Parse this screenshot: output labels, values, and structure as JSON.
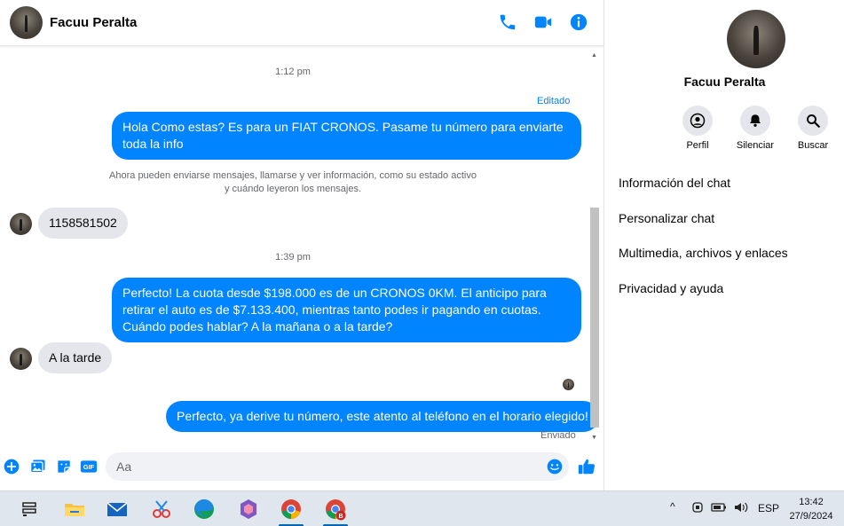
{
  "header": {
    "contact_name": "Facuu Peralta",
    "icons": [
      "phone-icon",
      "video-icon",
      "info-icon"
    ]
  },
  "messages": {
    "stamp_1": "1:12 pm",
    "edited_label": "Editado",
    "out_1": "Hola Como estas? Es para un FIAT CRONOS. Pasame tu número para enviarte toda la info",
    "system_notice_line1": "Ahora pueden enviarse mensajes, llamarse y ver información, como su estado activo",
    "system_notice_line2": "y cuándo leyeron los mensajes.",
    "in_1": "1158581502",
    "stamp_2": "1:39 pm",
    "out_2": "Perfecto! La cuota desde $198.000 es de un CRONOS 0KM. El anticipo para retirar el auto es de $7.133.400, mientras tanto podes ir pagando en cuotas. Cuándo podes hablar? A la mañana o a la tarde?",
    "in_2": "A la tarde",
    "out_3": "Perfecto, ya derive tu número, este atento al teléfono en el horario elegido!",
    "sent_label": "Enviado"
  },
  "composer": {
    "placeholder": "Aa",
    "icons": [
      "plus-icon",
      "image-icon",
      "sticker-icon",
      "gif-icon",
      "emoji-icon",
      "like-icon"
    ]
  },
  "info_pane": {
    "name": "Facuu Peralta",
    "actions": [
      {
        "label": "Perfil",
        "icon": "profile-icon"
      },
      {
        "label": "Silenciar",
        "icon": "bell-icon"
      },
      {
        "label": "Buscar",
        "icon": "search-icon"
      }
    ],
    "menu": [
      "Información del chat",
      "Personalizar chat",
      "Multimedia, archivos y enlaces",
      "Privacidad y ayuda"
    ]
  },
  "taskbar": {
    "apps": [
      "task-view-icon",
      "file-explorer-icon",
      "mail-icon",
      "snipping-tool-icon",
      "edge-icon",
      "copilot-icon",
      "chrome-icon",
      "chrome-profile-icon"
    ],
    "badge": "B",
    "language": "ESP",
    "time": "13:42",
    "date": "27/9/2024"
  },
  "colors": {
    "accent": "#0084ff",
    "bubble_in": "#e4e6eb",
    "taskbar": "#dfe6ee"
  }
}
